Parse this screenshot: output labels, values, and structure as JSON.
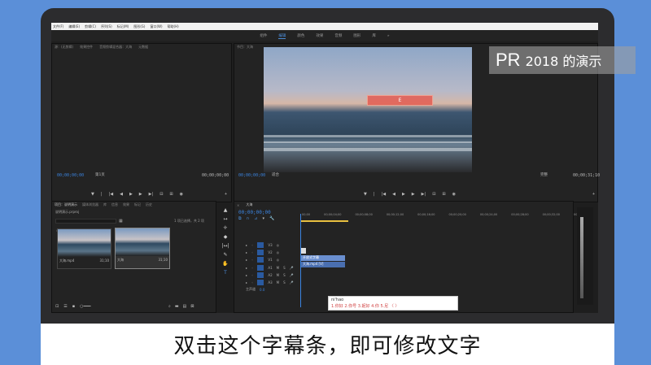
{
  "menu": [
    "文件(F)",
    "编辑(E)",
    "剪辑(C)",
    "序列(S)",
    "标记(M)",
    "图形(G)",
    "窗口(W)",
    "帮助(H)"
  ],
  "workspaces": [
    "组件",
    "编辑",
    "颜色",
    "效果",
    "音频",
    "图形",
    "库"
  ],
  "source_tabs": [
    "源：(无剪辑)",
    "效果控件",
    "音频剪辑混合器：大海",
    "元数据"
  ],
  "program_tabs": [
    "节目：大海"
  ],
  "source_timecode_left": "00;00;00;00",
  "source_page": "第1页",
  "source_timecode_right": "00;00;00;00",
  "program_timecode_left": "00;00;00;00",
  "program_fit": "适合",
  "program_quality": "完整",
  "program_timecode_right": "00;00;31;10",
  "subtitle_box_text": "E",
  "watermark": {
    "pr": "PR",
    "rest": "2018 的演示"
  },
  "project_tabs": [
    "项目：说明演示",
    "媒体浏览器",
    "库",
    "信息",
    "效果",
    "标记",
    "历史"
  ],
  "project_name": "说明演示.prproj",
  "project_count": "1 项已选择，共 2 项",
  "thumbs": [
    {
      "name": "大海.mp4",
      "duration": "31;10"
    },
    {
      "name": "大海",
      "duration": "31;10"
    }
  ],
  "timeline_tab": "大海",
  "timeline_timecode": "00;00;00;00",
  "ruler": [
    "00;00",
    "00;00;04;00",
    "00;00;08;00",
    "00;00;12;00",
    "00;00;16;00",
    "00;00;20;00",
    "00;00;24;00",
    "00;00;28;00",
    "00;00;32;00",
    "00;00;36;00"
  ],
  "tracks": [
    "V3",
    "V2",
    "V1",
    "A1",
    "A2",
    "A3",
    "主声道"
  ],
  "master_value": "0.0",
  "clips": {
    "v2": "开放式字幕",
    "v1": "大海.mp4 [V]"
  },
  "ime": {
    "pinyin": "ni'hao",
    "candidates": "1.你好  2.你号  3.妮好  4.你  5.尼 〈 〉"
  },
  "caption": "双击这个字幕条，即可修改文字",
  "colors": {
    "accent": "#3b84e0",
    "background": "#5b8fd8",
    "subtitle_box": "#e65046"
  }
}
